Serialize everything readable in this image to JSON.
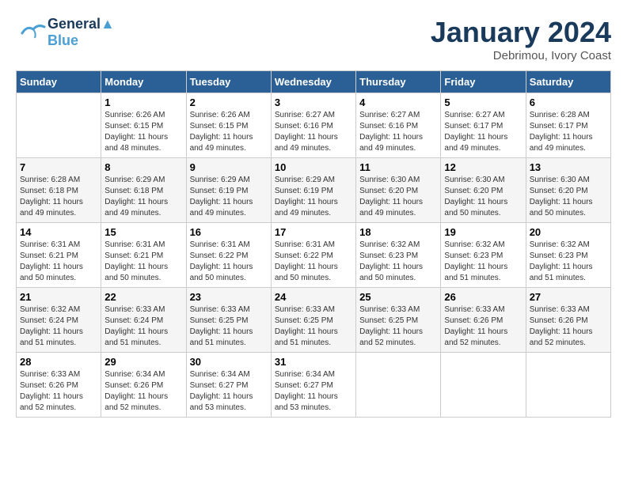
{
  "header": {
    "logo_line1": "General",
    "logo_line2": "Blue",
    "month": "January 2024",
    "location": "Debrimou, Ivory Coast"
  },
  "days_of_week": [
    "Sunday",
    "Monday",
    "Tuesday",
    "Wednesday",
    "Thursday",
    "Friday",
    "Saturday"
  ],
  "weeks": [
    [
      {
        "day": "",
        "info": ""
      },
      {
        "day": "1",
        "info": "Sunrise: 6:26 AM\nSunset: 6:15 PM\nDaylight: 11 hours and 48 minutes."
      },
      {
        "day": "2",
        "info": "Sunrise: 6:26 AM\nSunset: 6:15 PM\nDaylight: 11 hours and 49 minutes."
      },
      {
        "day": "3",
        "info": "Sunrise: 6:27 AM\nSunset: 6:16 PM\nDaylight: 11 hours and 49 minutes."
      },
      {
        "day": "4",
        "info": "Sunrise: 6:27 AM\nSunset: 6:16 PM\nDaylight: 11 hours and 49 minutes."
      },
      {
        "day": "5",
        "info": "Sunrise: 6:27 AM\nSunset: 6:17 PM\nDaylight: 11 hours and 49 minutes."
      },
      {
        "day": "6",
        "info": "Sunrise: 6:28 AM\nSunset: 6:17 PM\nDaylight: 11 hours and 49 minutes."
      }
    ],
    [
      {
        "day": "7",
        "info": "Sunrise: 6:28 AM\nSunset: 6:18 PM\nDaylight: 11 hours and 49 minutes."
      },
      {
        "day": "8",
        "info": "Sunrise: 6:29 AM\nSunset: 6:18 PM\nDaylight: 11 hours and 49 minutes."
      },
      {
        "day": "9",
        "info": "Sunrise: 6:29 AM\nSunset: 6:19 PM\nDaylight: 11 hours and 49 minutes."
      },
      {
        "day": "10",
        "info": "Sunrise: 6:29 AM\nSunset: 6:19 PM\nDaylight: 11 hours and 49 minutes."
      },
      {
        "day": "11",
        "info": "Sunrise: 6:30 AM\nSunset: 6:20 PM\nDaylight: 11 hours and 49 minutes."
      },
      {
        "day": "12",
        "info": "Sunrise: 6:30 AM\nSunset: 6:20 PM\nDaylight: 11 hours and 50 minutes."
      },
      {
        "day": "13",
        "info": "Sunrise: 6:30 AM\nSunset: 6:20 PM\nDaylight: 11 hours and 50 minutes."
      }
    ],
    [
      {
        "day": "14",
        "info": "Sunrise: 6:31 AM\nSunset: 6:21 PM\nDaylight: 11 hours and 50 minutes."
      },
      {
        "day": "15",
        "info": "Sunrise: 6:31 AM\nSunset: 6:21 PM\nDaylight: 11 hours and 50 minutes."
      },
      {
        "day": "16",
        "info": "Sunrise: 6:31 AM\nSunset: 6:22 PM\nDaylight: 11 hours and 50 minutes."
      },
      {
        "day": "17",
        "info": "Sunrise: 6:31 AM\nSunset: 6:22 PM\nDaylight: 11 hours and 50 minutes."
      },
      {
        "day": "18",
        "info": "Sunrise: 6:32 AM\nSunset: 6:23 PM\nDaylight: 11 hours and 50 minutes."
      },
      {
        "day": "19",
        "info": "Sunrise: 6:32 AM\nSunset: 6:23 PM\nDaylight: 11 hours and 51 minutes."
      },
      {
        "day": "20",
        "info": "Sunrise: 6:32 AM\nSunset: 6:23 PM\nDaylight: 11 hours and 51 minutes."
      }
    ],
    [
      {
        "day": "21",
        "info": "Sunrise: 6:32 AM\nSunset: 6:24 PM\nDaylight: 11 hours and 51 minutes."
      },
      {
        "day": "22",
        "info": "Sunrise: 6:33 AM\nSunset: 6:24 PM\nDaylight: 11 hours and 51 minutes."
      },
      {
        "day": "23",
        "info": "Sunrise: 6:33 AM\nSunset: 6:25 PM\nDaylight: 11 hours and 51 minutes."
      },
      {
        "day": "24",
        "info": "Sunrise: 6:33 AM\nSunset: 6:25 PM\nDaylight: 11 hours and 51 minutes."
      },
      {
        "day": "25",
        "info": "Sunrise: 6:33 AM\nSunset: 6:25 PM\nDaylight: 11 hours and 52 minutes."
      },
      {
        "day": "26",
        "info": "Sunrise: 6:33 AM\nSunset: 6:26 PM\nDaylight: 11 hours and 52 minutes."
      },
      {
        "day": "27",
        "info": "Sunrise: 6:33 AM\nSunset: 6:26 PM\nDaylight: 11 hours and 52 minutes."
      }
    ],
    [
      {
        "day": "28",
        "info": "Sunrise: 6:33 AM\nSunset: 6:26 PM\nDaylight: 11 hours and 52 minutes."
      },
      {
        "day": "29",
        "info": "Sunrise: 6:34 AM\nSunset: 6:26 PM\nDaylight: 11 hours and 52 minutes."
      },
      {
        "day": "30",
        "info": "Sunrise: 6:34 AM\nSunset: 6:27 PM\nDaylight: 11 hours and 53 minutes."
      },
      {
        "day": "31",
        "info": "Sunrise: 6:34 AM\nSunset: 6:27 PM\nDaylight: 11 hours and 53 minutes."
      },
      {
        "day": "",
        "info": ""
      },
      {
        "day": "",
        "info": ""
      },
      {
        "day": "",
        "info": ""
      }
    ]
  ]
}
